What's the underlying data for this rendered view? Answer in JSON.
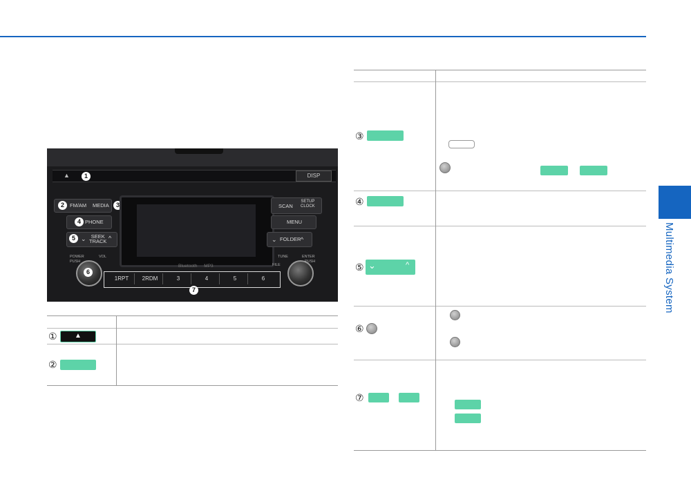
{
  "sidebar": {
    "section_label": "Multimedia System"
  },
  "radio": {
    "labels": {
      "fm_am": "FM/AM",
      "media": "MEDIA",
      "phone": "PHONE",
      "seek_track": "SEEK\nTRACK",
      "scan": "SCAN",
      "setup_clock": "SETUP\nCLOCK",
      "menu": "MENU",
      "folder": "FOLDER",
      "disp": "DISP",
      "power": "POWER",
      "push": "PUSH",
      "vol": "VOL",
      "tune": "TUNE",
      "file": "FILE",
      "enter": "ENTER",
      "bluetooth": "Bluetooth",
      "mp3": "MP3"
    },
    "presets": [
      "1RPT",
      "2RDM",
      "3",
      "4",
      "5",
      "6"
    ],
    "callouts": [
      "1",
      "2",
      "3",
      "4",
      "5",
      "6",
      "7"
    ]
  },
  "left_table": {
    "rows": [
      {
        "number": "①"
      },
      {
        "number": "②"
      }
    ]
  },
  "right_table": {
    "rows": [
      {
        "number": "③"
      },
      {
        "number": "④"
      },
      {
        "number": "⑤"
      },
      {
        "number": "⑥"
      },
      {
        "number": "⑦"
      }
    ]
  },
  "colors": {
    "accent_blue": "#1565c0",
    "key_green": "#5dd3a8"
  }
}
